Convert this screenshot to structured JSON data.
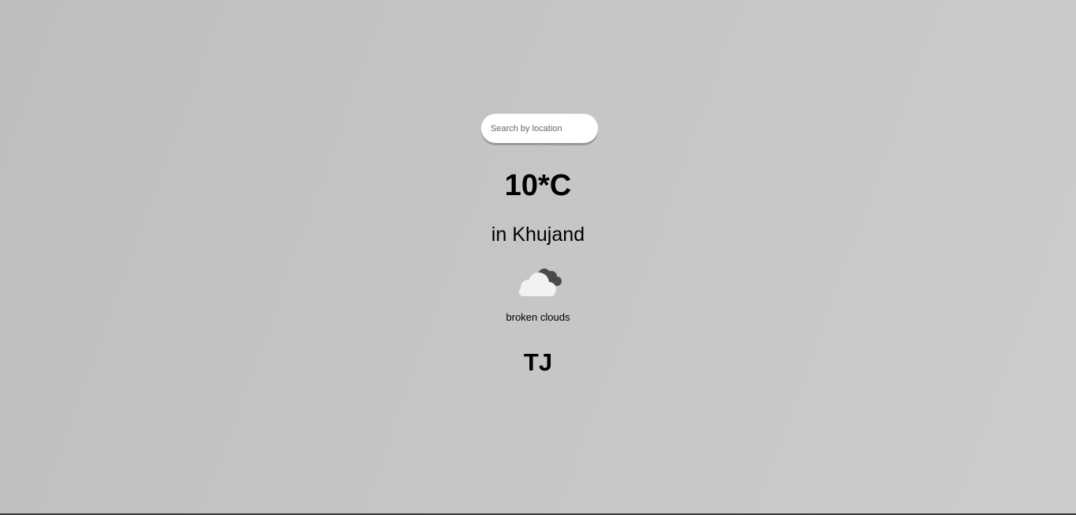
{
  "search": {
    "placeholder": "Search by location",
    "value": ""
  },
  "weather": {
    "temperature": "10*C",
    "location": "in Khujand",
    "icon": "broken-clouds-icon",
    "description": "broken clouds",
    "country": "TJ"
  },
  "colors": {
    "background_start": "#bdbebf",
    "background_end": "#cbccce",
    "cloud_front": "#f2f2f2",
    "cloud_back": "#4a4a4a"
  }
}
